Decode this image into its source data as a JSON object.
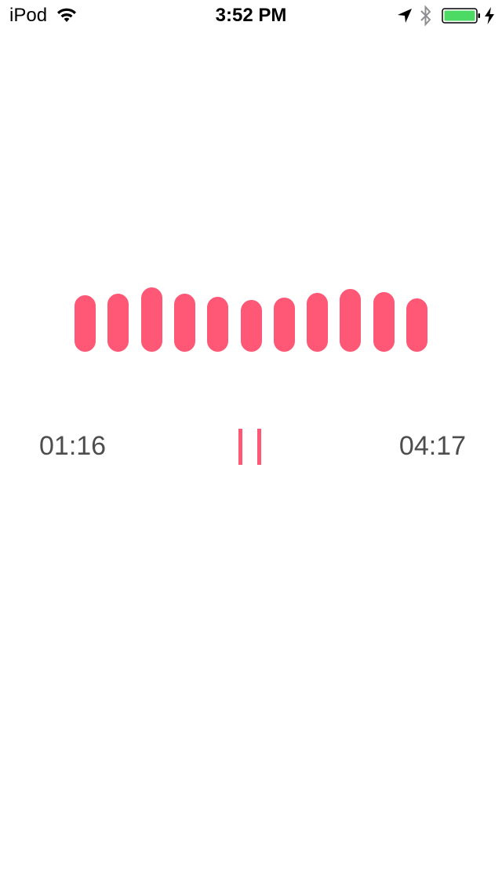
{
  "status_bar": {
    "carrier": "iPod",
    "time": "3:52 PM",
    "icons": [
      "wifi-icon",
      "location-icon",
      "bluetooth-icon",
      "battery-icon",
      "charging-icon"
    ],
    "battery_color": "#4cd964"
  },
  "player": {
    "accent_color": "#ff5876",
    "elapsed": "01:16",
    "total": "04:17",
    "state": "playing",
    "control_icon": "pause-icon",
    "equalizer_levels": [
      0.88,
      0.9,
      1.0,
      0.9,
      0.85,
      0.81,
      0.84,
      0.92,
      0.98,
      0.93,
      0.83
    ]
  }
}
